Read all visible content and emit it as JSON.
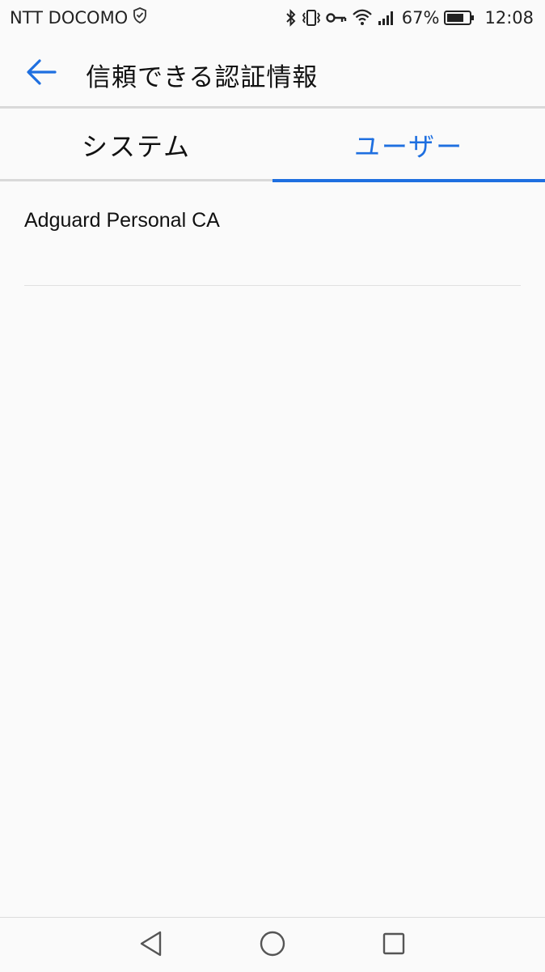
{
  "status_bar": {
    "carrier": "NTT DOCOMO",
    "battery_percent": "67%",
    "time": "12:08",
    "icons": [
      "shield-icon",
      "bluetooth-icon",
      "vibrate-icon",
      "vpn-key-icon",
      "wifi-icon",
      "signal-icon",
      "battery-icon"
    ]
  },
  "app_bar": {
    "title": "信頼できる認証情報",
    "back_icon": "arrow-back-icon"
  },
  "tabs": [
    {
      "label": "システム",
      "active": false
    },
    {
      "label": "ユーザー",
      "active": true
    }
  ],
  "certificates": [
    {
      "name": "Adguard Personal CA"
    }
  ],
  "nav_bar": {
    "icons": [
      "nav-back-icon",
      "nav-home-icon",
      "nav-recents-icon"
    ]
  },
  "colors": {
    "accent": "#1e6fe0",
    "background": "#fafafa",
    "divider": "#d9d9d9",
    "text": "#111111"
  }
}
